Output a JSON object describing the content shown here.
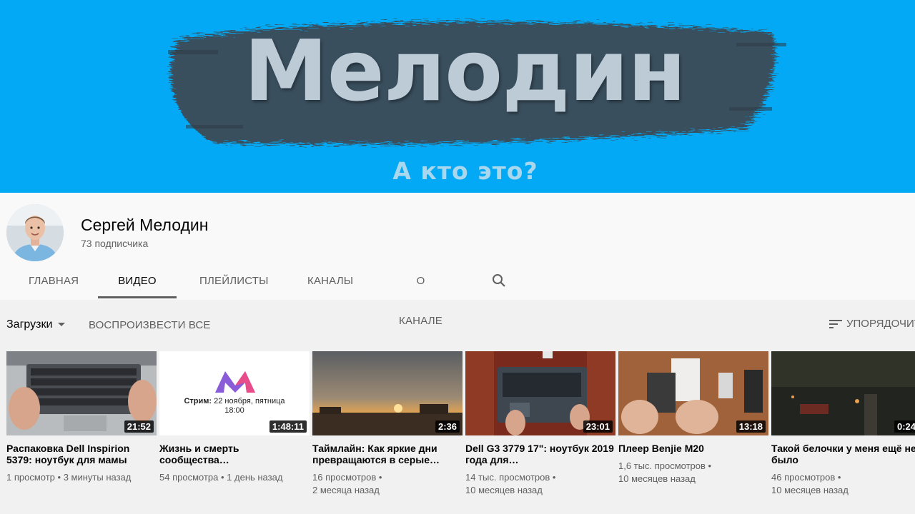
{
  "banner": {
    "title": "Мелодин",
    "subtitle": "А кто это?",
    "bg_color": "#03a9f4"
  },
  "channel": {
    "name": "Сергей Мелодин",
    "subscribers": "73 подписчика"
  },
  "tabs": [
    {
      "label": "ГЛАВНАЯ",
      "active": false
    },
    {
      "label": "ВИДЕО",
      "active": true
    },
    {
      "label": "ПЛЕЙЛИСТЫ",
      "active": false
    },
    {
      "label": "КАНАЛЫ",
      "active": false
    },
    {
      "label": "О КАНАЛЕ",
      "active": false
    }
  ],
  "tab_search_icon": "search-icon",
  "filter": {
    "uploads_label": "Загрузки",
    "play_all_label": "ВОСПРОИЗВЕСТИ ВСЕ",
    "sort_label": "УПОРЯДОЧИТЬ"
  },
  "videos": [
    {
      "title": "Распаковка Dell Inspirion 5379: ноутбук для мамы",
      "duration": "21:52",
      "views": "1 просмотр",
      "age": "3 минуты назад"
    },
    {
      "title": "Жизнь и смерть сообщества…",
      "duration": "1:48:11",
      "views": "54 просмотра",
      "age": "1 день назад",
      "thumb_text_bold": "Стрим:",
      "thumb_text_line1": "22 ноября, пятница",
      "thumb_text_line2": "18:00"
    },
    {
      "title": "Таймлайн: Как яркие дни превращаются в серые…",
      "duration": "2:36",
      "views": "16 просмотров",
      "age": "2 месяца назад"
    },
    {
      "title": "Dell G3 3779 17\": ноутбук 2019 года для…",
      "duration": "23:01",
      "views": "14 тыс. просмотров",
      "age": "10 месяцев назад"
    },
    {
      "title": "Плеер Benjie M20",
      "duration": "13:18",
      "views": "1,6 тыс. просмотров",
      "age": "10 месяцев назад"
    },
    {
      "title": "Такой белочки у меня ещё не было",
      "duration": "0:24",
      "views": "46 просмотров",
      "age": "10 месяцев назад"
    }
  ]
}
